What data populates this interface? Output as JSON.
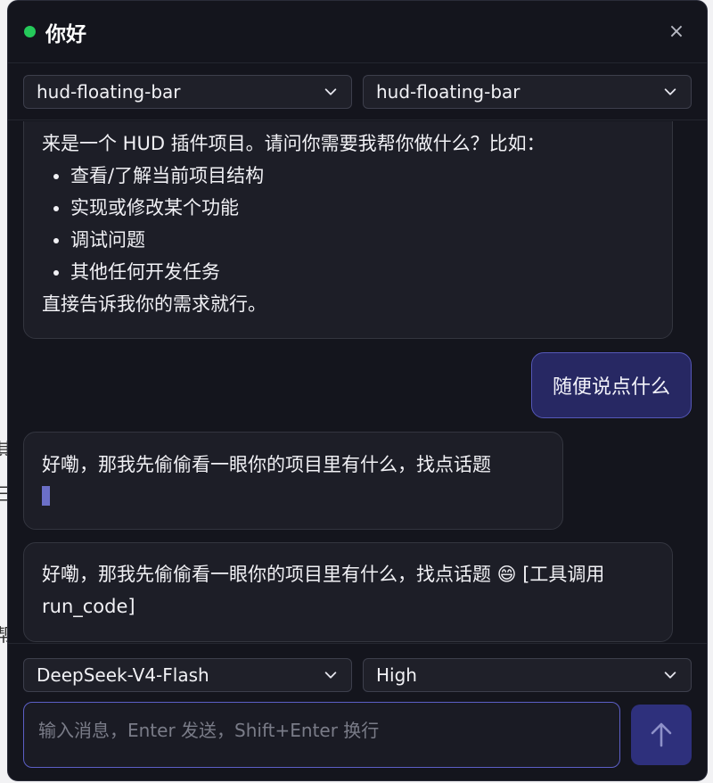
{
  "window": {
    "title": "你好",
    "status_color": "#25c95a",
    "close_label": "×"
  },
  "selectors": {
    "project_left": "hud-floating-bar",
    "project_right": "hud-floating-bar"
  },
  "messages": [
    {
      "role": "assistant",
      "intro": "来是一个 HUD 插件项目。请问你需要我帮你做什么？比如：",
      "items": [
        "查看/了解当前项目结构",
        "实现或修改某个功能",
        "调试问题",
        "其他任何开发任务"
      ],
      "outro": "直接告诉我你的需求就行。"
    },
    {
      "role": "user",
      "text": "随便说点什么"
    },
    {
      "role": "assistant",
      "text": "好嘞，那我先偷偷看一眼你的项目里有什么，找点话题",
      "streaming": true
    },
    {
      "role": "assistant",
      "text": "好嘞，那我先偷偷看一眼你的项目里有什么，找点话题 😄 [工具调用 run_code]"
    }
  ],
  "controls": {
    "model": "DeepSeek-V4-Flash",
    "effort": "High"
  },
  "input": {
    "placeholder": "输入消息，Enter 发送，Shift+Enter 换行",
    "value": ""
  },
  "icons": {
    "send": "arrow-up-icon",
    "close": "close-icon",
    "dropdown": "chevron-down-icon"
  },
  "colors": {
    "accent": "#5c5fc6",
    "user_bubble": "#272863",
    "panel_bg": "#14151d"
  }
}
